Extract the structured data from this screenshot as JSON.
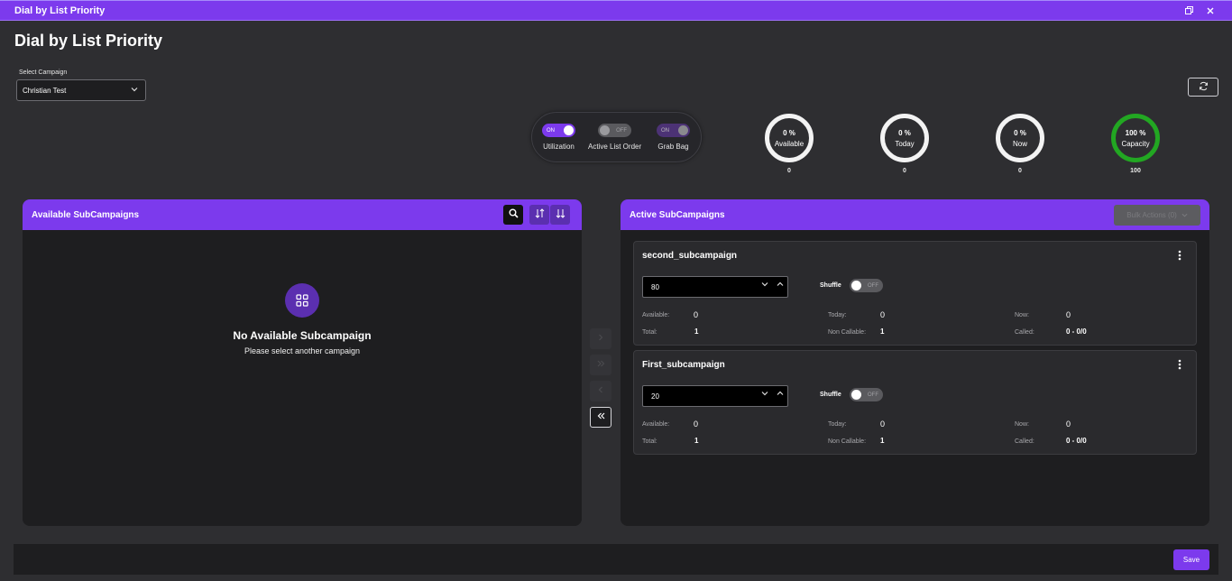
{
  "window": {
    "title": "Dial by List Priority"
  },
  "page": {
    "title": "Dial by List Priority"
  },
  "campaign": {
    "label": "Select Campaign",
    "value": "Christian Test"
  },
  "toggles": [
    {
      "label": "Utilization",
      "state": "ON"
    },
    {
      "label": "Active List Order",
      "state": "OFF"
    },
    {
      "label": "Grab Bag",
      "state": "ON"
    }
  ],
  "gauges": [
    {
      "pct": "0 %",
      "label": "Available",
      "value": "0"
    },
    {
      "pct": "0 %",
      "label": "Today",
      "value": "0"
    },
    {
      "pct": "0 %",
      "label": "Now",
      "value": "0"
    },
    {
      "pct": "100 %",
      "label": "Capacity",
      "value": "100"
    }
  ],
  "available": {
    "title": "Available SubCampaigns",
    "empty_title": "No Available Subcampaign",
    "empty_sub": "Please select another campaign"
  },
  "active": {
    "title": "Active SubCampaigns",
    "bulk_label": "Bulk Actions (0)",
    "cards": [
      {
        "name": "second_subcampaign",
        "priority": "80",
        "shuffle_label": "Shuffle",
        "shuffle_state": "OFF",
        "labels": {
          "available": "Available:",
          "today": "Today:",
          "now": "Now:",
          "total": "Total:",
          "non_callable": "Non Callable:",
          "called": "Called:"
        },
        "available": "0",
        "today": "0",
        "now": "0",
        "total": "1",
        "non_callable": "1",
        "called": "0 - 0/0"
      },
      {
        "name": "First_subcampaign",
        "priority": "20",
        "shuffle_label": "Shuffle",
        "shuffle_state": "OFF",
        "labels": {
          "available": "Available:",
          "today": "Today:",
          "now": "Now:",
          "total": "Total:",
          "non_callable": "Non Callable:",
          "called": "Called:"
        },
        "available": "0",
        "today": "0",
        "now": "0",
        "total": "1",
        "non_callable": "1",
        "called": "0 - 0/0"
      }
    ]
  },
  "footer": {
    "save_label": "Save"
  },
  "icons": {
    "titlebar": [
      "restore-icon",
      "close-icon"
    ],
    "refresh": "refresh-icon",
    "search": "search-icon",
    "sort": [
      "sort-asc-icon",
      "sort-desc-icon"
    ],
    "transfer": [
      "chevron-right-icon",
      "double-chevron-right-icon",
      "chevron-left-icon",
      "double-chevron-left-icon"
    ],
    "empty": "grid-icon",
    "menu": "kebab-icon"
  },
  "colors": {
    "accent": "#7c3aed",
    "capacity_ring": "#22a722",
    "ring": "#f3f3f3"
  }
}
